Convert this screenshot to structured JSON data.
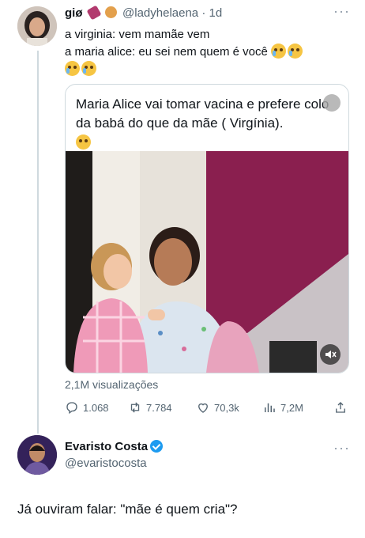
{
  "tweet1": {
    "name": "giø",
    "handle": "@ladyhelaena",
    "time": "· 1d",
    "line1": "a virginia: vem mamãe vem",
    "line2": "a maria alice: eu sei nem quem é você",
    "quote": {
      "text": "Maria Alice vai tomar  vacina e prefere colo da babá do que da mãe ( Virgínia)."
    },
    "views": "2,1M visualizações",
    "actions": {
      "replies": "1.068",
      "retweets": "7.784",
      "likes": "70,3k",
      "views": "7,2M"
    }
  },
  "tweet2": {
    "name": "Evaristo Costa",
    "handle": "@evaristocosta",
    "text": "Já ouviram falar: \"mãe é quem cria\"?"
  },
  "icons": {
    "reply": "reply-icon",
    "retweet": "retweet-icon",
    "like": "heart-icon",
    "views": "bar-chart-icon",
    "share": "share-icon",
    "more": "more-dots-icon",
    "verified": "verified-badge-icon",
    "mute": "mute-icon"
  },
  "colors": {
    "text": "#0f1419",
    "secondary": "#536471",
    "border": "#cfd9de",
    "verified": "#1d9bf0"
  }
}
